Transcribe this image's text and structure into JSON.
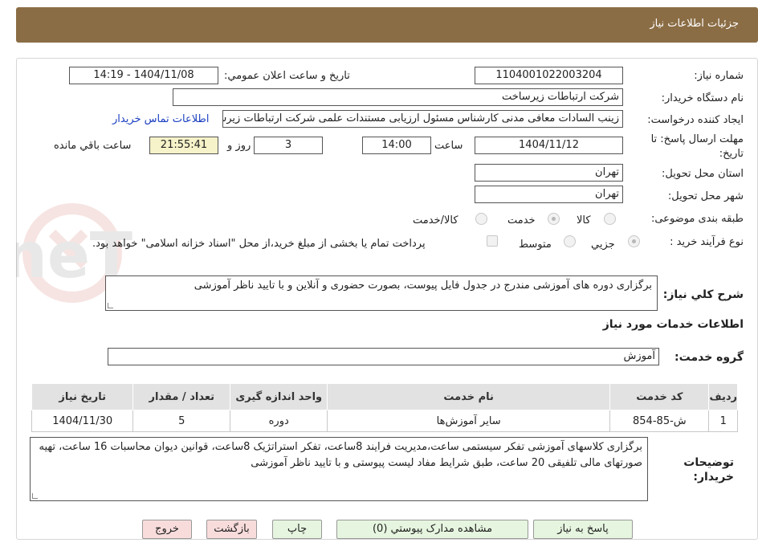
{
  "header": {
    "title": "جزئیات اطلاعات نیاز"
  },
  "watermark": {
    "text": "AriaTender.neT"
  },
  "fields": {
    "need_number_label": "شماره نیاز:",
    "need_number": "1104001022003204",
    "announce_label": "تاریخ و ساعت اعلان عمومي:",
    "announce_value": "1404/11/08 - 14:19",
    "buyer_org_label": "نام دستگاه خریدار:",
    "buyer_org": "شرکت ارتباطات زیرساخت",
    "creator_label": "ایجاد کننده درخواست:",
    "creator": "زینب السادات معافی مدنی کارشناس مسئول ارزیابی مستندات علمی شرکت ارتباطات زیرساخت",
    "contact_link": "اطلاعات تماس خریدار",
    "deadline_label_1": "مهلت ارسال پاسخ: تا",
    "deadline_label_2": "تاریخ:",
    "deadline_date": "1404/11/12",
    "time_label": "ساعت",
    "deadline_time": "14:00",
    "days": "3",
    "days_label": "روز و",
    "remaining_time": "21:55:41",
    "remaining_label": "ساعت باقي مانده",
    "province_label": "استان محل تحویل:",
    "province": "تهران",
    "city_label": "شهر محل تحویل:",
    "city": "تهران",
    "category_label": "طبقه بندی موضوعی:",
    "category_options": [
      "کالا",
      "خدمت",
      "کالا/خدمت"
    ],
    "category_selected": "خدمت",
    "process_label": "نوع فرآیند خرید :",
    "process_options": [
      "جزيي",
      "متوسط"
    ],
    "process_selected": "جزيي",
    "payment_note": "پرداخت تمام یا بخشی از مبلغ خرید،از محل \"اسناد خزانه اسلامی\" خواهد بود.",
    "description_label": "شرح کلي نیاز:",
    "description": "برگزاری دوره های آموزشی مندرج در جدول فایل پیوست، بصورت حضوری و آنلاین و با تایید ناظر آموزشی"
  },
  "services": {
    "section_title": "اطلاعات خدمات مورد نیاز",
    "group_label": "گروه خدمت:",
    "group_value": "آموزش",
    "columns": [
      "ردیف",
      "کد خدمت",
      "نام خدمت",
      "واحد اندازه گیری",
      "تعداد / مقدار",
      "تاریخ نیاز"
    ],
    "rows": [
      [
        "1",
        "ش-85-854",
        "سایر آموزش‌ها",
        "دوره",
        "5",
        "1404/11/30"
      ]
    ]
  },
  "buyer_notes": {
    "label_1": "توضیحات",
    "label_2": "خریدار:",
    "text": "برگزاری کلاسهای آموزشی تفکر سیستمی ساعت،مدیریت فرایند 8ساعت، تفکر استراتژیک 8ساعت، قوانین دیوان محاسبات  16 ساعت، تهیه صورتهای مالی تلفیقی 20 ساعت، طبق شرایط مفاد لیست پیوستی و با تایید ناظر آموزشی"
  },
  "buttons": {
    "reply": "پاسخ به نیاز",
    "view_docs": "مشاهده مدارک پیوستي (0)",
    "print": "چاپ",
    "back": "بازگشت",
    "exit": "خروج"
  }
}
